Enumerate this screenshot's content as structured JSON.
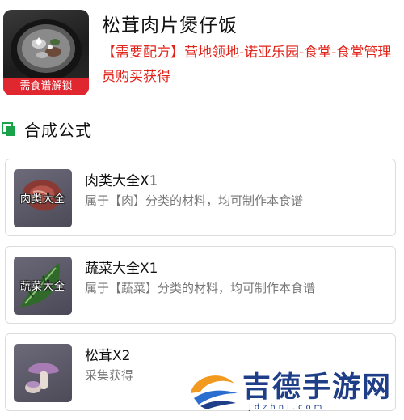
{
  "recipe": {
    "title": "松茸肉片煲仔饭",
    "lock_badge": "需食谱解锁",
    "source": "【需要配方】营地领地-诺亚乐园-食堂-食堂管理员购买获得",
    "dish_icon": "clay-pot-rice-icon"
  },
  "section": {
    "title": "合成公式",
    "icon": "square-bullet-icon",
    "accent_color": "#1aa34a"
  },
  "ingredients": [
    {
      "name": "肉类大全X1",
      "description": "属于【肉】分类的材料，均可制作本食谱",
      "thumb_caption": "肉类大全",
      "icon": "meat-icon"
    },
    {
      "name": "蔬菜大全X1",
      "description": "属于【蔬菜】分类的材料，均可制作本食谱",
      "thumb_caption": "蔬菜大全",
      "icon": "vegetable-leaf-icon"
    },
    {
      "name": "松茸X2",
      "description": "采集获得",
      "thumb_caption": "",
      "icon": "matsutake-mushroom-icon"
    }
  ],
  "colors": {
    "source_text": "#e2231a",
    "lock_badge_bg": "#e0262f",
    "watermark_blue": "#1e3e88",
    "watermark_orange": "#f29a1f"
  },
  "watermark": {
    "text": "吉德手游网",
    "url": "jdzhnl.com"
  }
}
